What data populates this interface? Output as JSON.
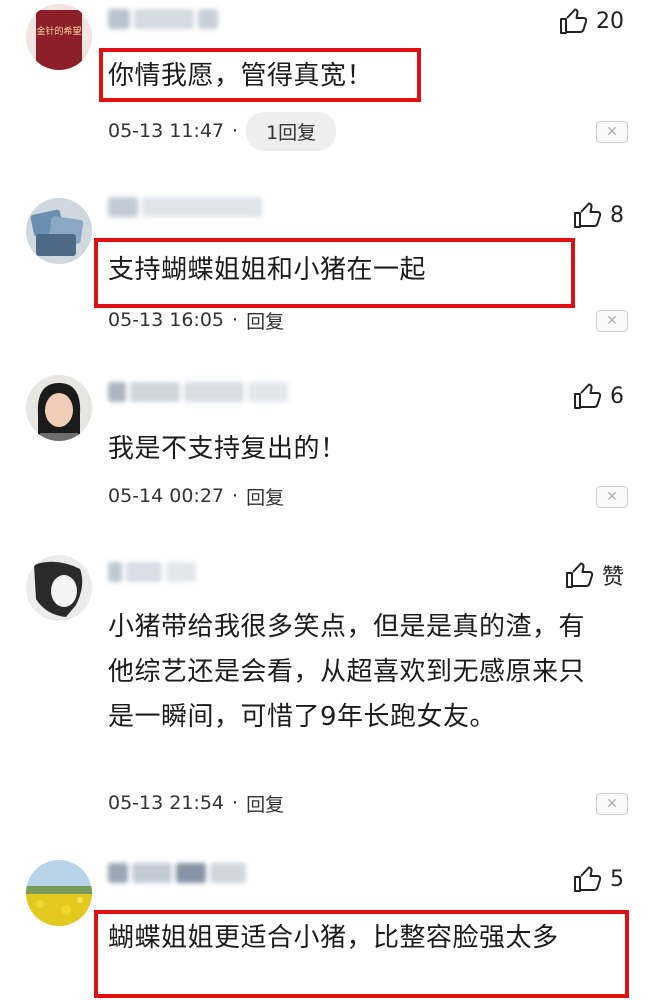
{
  "comments": [
    {
      "likes": "20",
      "text": "你情我愿，管得真宽！",
      "time": "05-13 11:47",
      "separator": "·",
      "reply_label": "1回复",
      "highlighted": true,
      "avatar_icon": "book-avatar",
      "avatar_text": "金针的希望"
    },
    {
      "likes": "8",
      "text": "支持蝴蝶姐姐和小猪在一起",
      "time": "05-13 16:05",
      "separator": "·",
      "reply_label": "回复",
      "highlighted": true,
      "avatar_icon": "cards-avatar"
    },
    {
      "likes": "6",
      "text": "我是不支持复出的！",
      "time": "05-14 00:27",
      "separator": "·",
      "reply_label": "回复",
      "highlighted": false,
      "avatar_icon": "woman-avatar"
    },
    {
      "likes": "赞",
      "text": "小猪带给我很多笑点，但是是真的渣，有他综艺还是会看，从超喜欢到无感原来只是一瞬间，可惜了9年长跑女友。",
      "time": "05-13 21:54",
      "separator": "·",
      "reply_label": "回复",
      "highlighted": false,
      "avatar_icon": "sketch-avatar"
    },
    {
      "likes": "5",
      "text": "蝴蝶姐姐更适合小猪，比整容脸强太多",
      "highlighted": true,
      "avatar_icon": "flower-field-avatar"
    }
  ],
  "icons": {
    "like": "thumbs-up-icon",
    "dismiss": "close-icon"
  },
  "dismiss_glyph": "✕",
  "colors": {
    "highlight_border": "#e01010",
    "pill_bg": "#eeeeee"
  }
}
